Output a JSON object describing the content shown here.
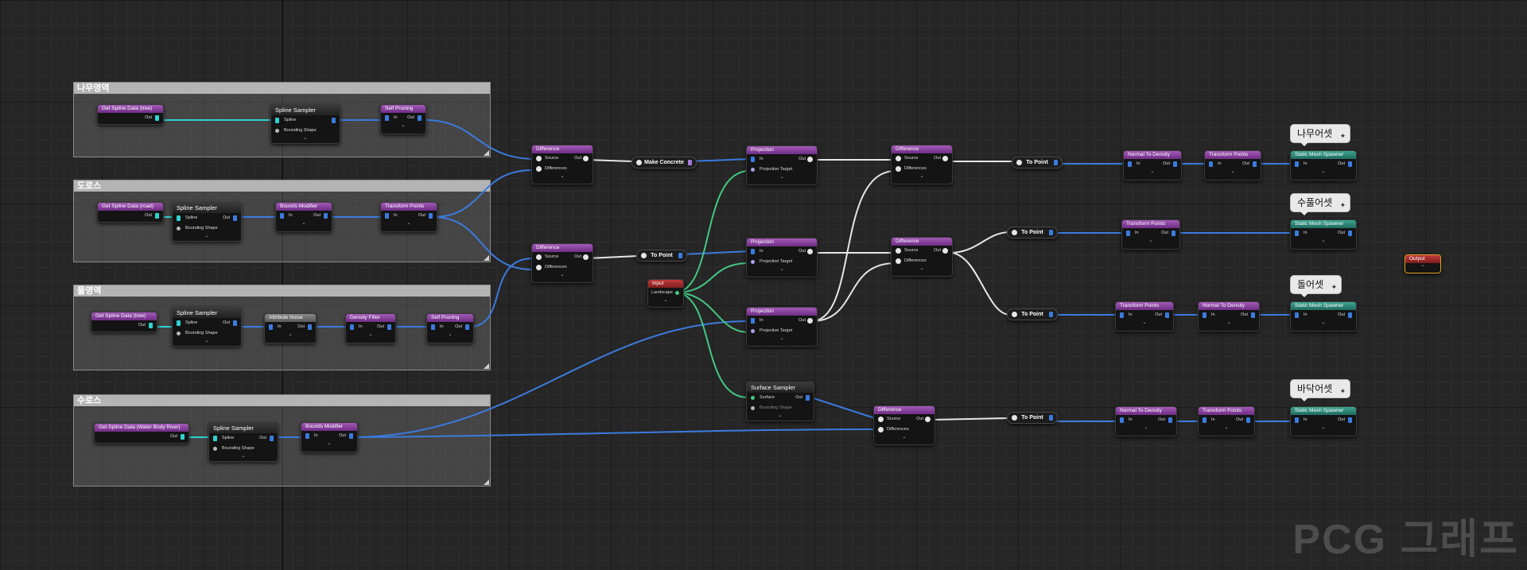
{
  "comments": [
    {
      "title": "나무영역"
    },
    {
      "title": "도로스"
    },
    {
      "title": "풀영역"
    },
    {
      "title": "수로스"
    }
  ],
  "nodes": {
    "tree_get_spline": {
      "title": "Get Spline Data (tree)"
    },
    "tree_spline_sampler": {
      "title": "Spline Sampler"
    },
    "tree_self_pruning": {
      "title": "Self Pruning"
    },
    "road_get_spline": {
      "title": "Get Spline Data (road)"
    },
    "road_spline_sampler": {
      "title": "Spline Sampler"
    },
    "road_bounds_modifier": {
      "title": "Bounds Modifier"
    },
    "road_transform_points": {
      "title": "Transform Points"
    },
    "grass_get_spline": {
      "title": "Get Spline Data (tree)"
    },
    "grass_spline_sampler": {
      "title": "Spline Sampler"
    },
    "grass_attribute_noise": {
      "title": "Attribute Noise"
    },
    "grass_density_filter": {
      "title": "Density Filter"
    },
    "grass_self_pruning": {
      "title": "Self Pruning"
    },
    "water_get_spline": {
      "title": "Get Spline Data (Water Body River)"
    },
    "water_spline_sampler": {
      "title": "Spline Sampler"
    },
    "water_bounds_modifier": {
      "title": "Bounds Modifier"
    },
    "diff1": {
      "title": "Difference"
    },
    "diff2": {
      "title": "Difference"
    },
    "make_concrete": {
      "title": "Make Concrete"
    },
    "to_point_a": {
      "title": "To Point"
    },
    "input": {
      "title": "Input"
    },
    "proj1": {
      "title": "Projection"
    },
    "proj2": {
      "title": "Projection"
    },
    "proj3": {
      "title": "Projection"
    },
    "surface_sampler": {
      "title": "Surface Sampler"
    },
    "diff3": {
      "title": "Difference"
    },
    "diff4": {
      "title": "Difference"
    },
    "diff5": {
      "title": "Difference"
    },
    "to_point_1": {
      "title": "To Point"
    },
    "to_point_2": {
      "title": "To Point"
    },
    "to_point_3": {
      "title": "To Point"
    },
    "to_point_4": {
      "title": "To Point"
    },
    "r1_normal": {
      "title": "Normal To Density"
    },
    "r1_transform": {
      "title": "Transform Points"
    },
    "r1_spawner": {
      "title": "Static Mesh Spawner"
    },
    "r2_transform": {
      "title": "Transform Points"
    },
    "r2_spawner": {
      "title": "Static Mesh Spawner"
    },
    "r3_transform": {
      "title": "Transform Points"
    },
    "r3_normal": {
      "title": "Normal To Density"
    },
    "r3_spawner": {
      "title": "Static Mesh Spawner"
    },
    "r4_normal": {
      "title": "Normal To Density"
    },
    "r4_transform": {
      "title": "Transform Points"
    },
    "r4_spawner": {
      "title": "Static Mesh Spawner"
    },
    "output": {
      "title": "Output"
    }
  },
  "pins": {
    "out": "Out",
    "in": "In",
    "spline": "Spline",
    "bounding_shape": "Bounding Shape",
    "source": "Source",
    "differences": "Differences",
    "projection_target": "Projection Target",
    "landscape": "Landscape",
    "surface": "Surface"
  },
  "bubbles": {
    "r1": "나무어셋",
    "r2": "수풀어셋",
    "r3": "돌어셋",
    "r4": "바닥어셋"
  },
  "watermark": "PCG 그래프",
  "colors": {
    "spatial_wire": "#3b7bde",
    "landscape_wire": "#43c882",
    "point_wire": "#e6e6e6",
    "spline_wire": "#2fd1d1"
  }
}
